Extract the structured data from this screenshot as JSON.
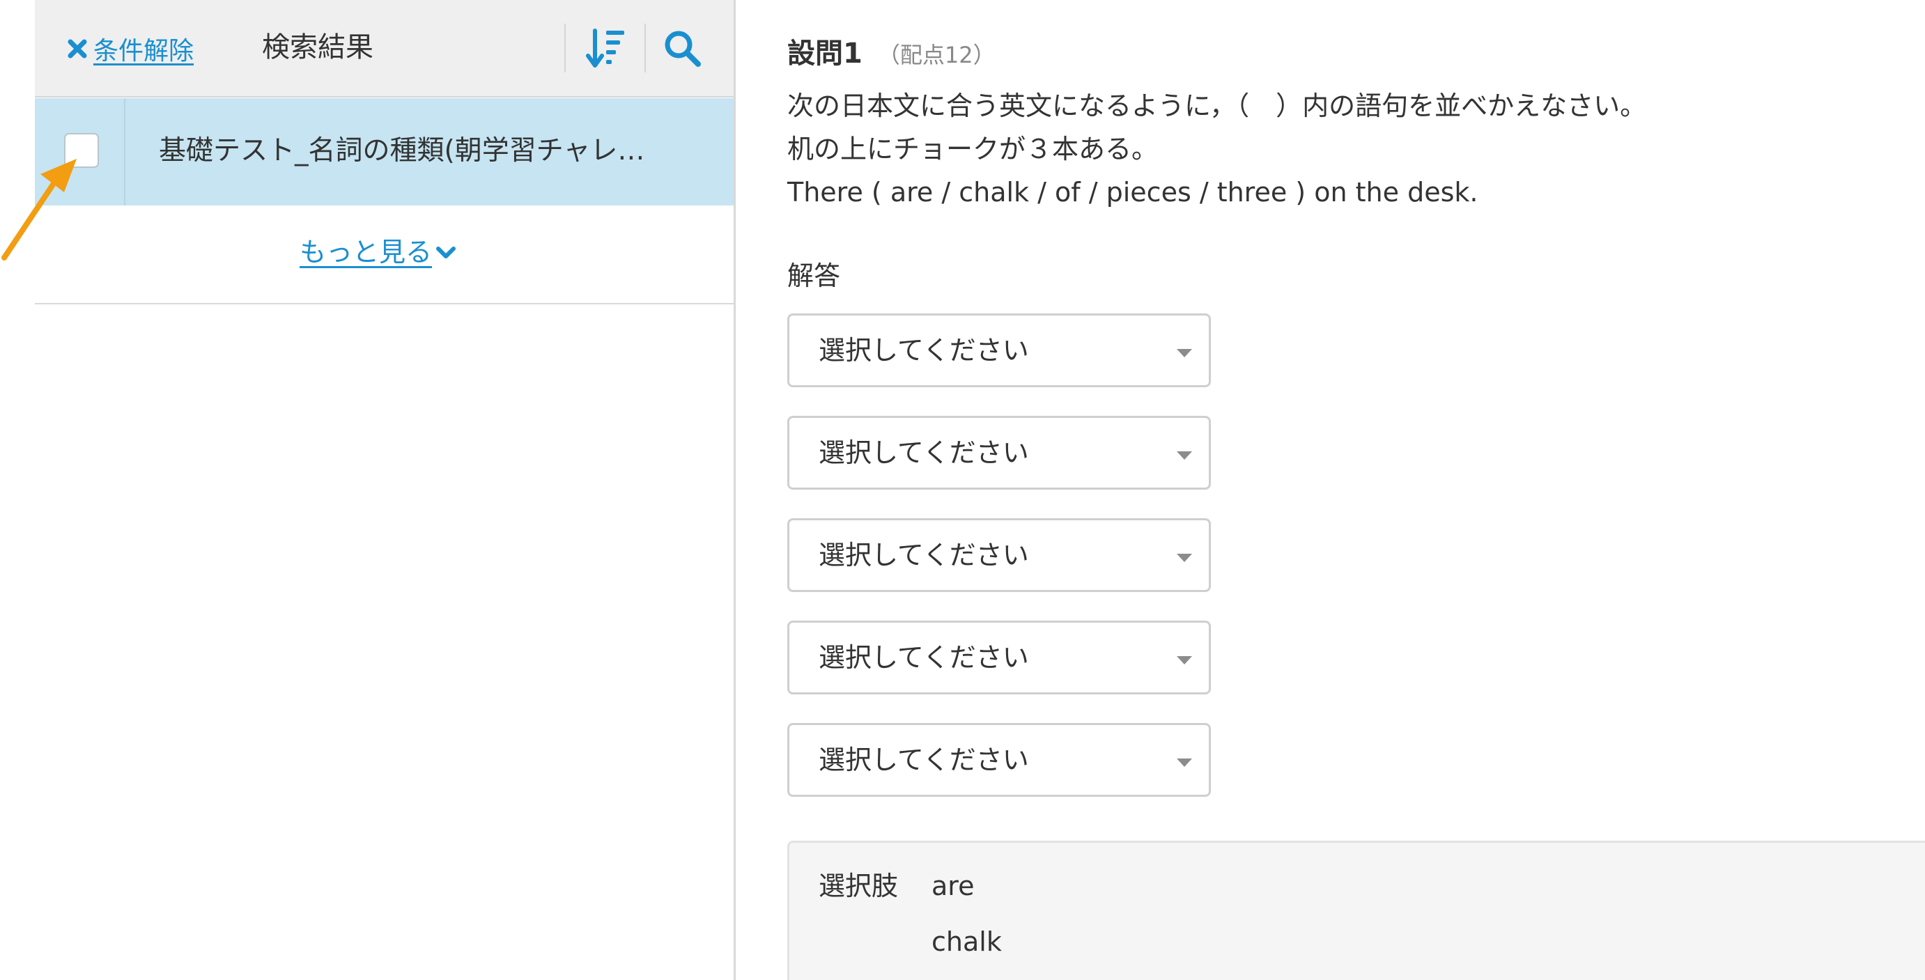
{
  "colors": {
    "accent": "#1a8fd0",
    "selected_row_bg": "#c6e4f2",
    "header_bg": "#efefef",
    "annotation_arrow": "#f29d12"
  },
  "left_panel": {
    "clear_filter": {
      "icon": "close-icon",
      "label": "条件解除"
    },
    "title": "検索結果",
    "sort_icon": "sort-icon",
    "search_icon": "search-icon",
    "results": [
      {
        "title": "基礎テスト_名詞の種類(朝学習チャレ…",
        "checked": false
      }
    ],
    "more": {
      "label": "もっと見る",
      "icon": "chevron-down-icon"
    }
  },
  "question": {
    "title": "設問1",
    "score": "（配点12）",
    "instruction": "次の日本文に合う英文になるように，（　）内の語句を並べかえなさい。",
    "japanese": "机の上にチョークが３本ある。",
    "english": "There ( are / chalk / of / pieces / three ) on the desk."
  },
  "answer": {
    "label": "解答",
    "selects": [
      {
        "value": "選択してください"
      },
      {
        "value": "選択してください"
      },
      {
        "value": "選択してください"
      },
      {
        "value": "選択してください"
      },
      {
        "value": "選択してください"
      }
    ]
  },
  "choices": {
    "label": "選択肢",
    "items": [
      "are",
      "chalk"
    ]
  }
}
